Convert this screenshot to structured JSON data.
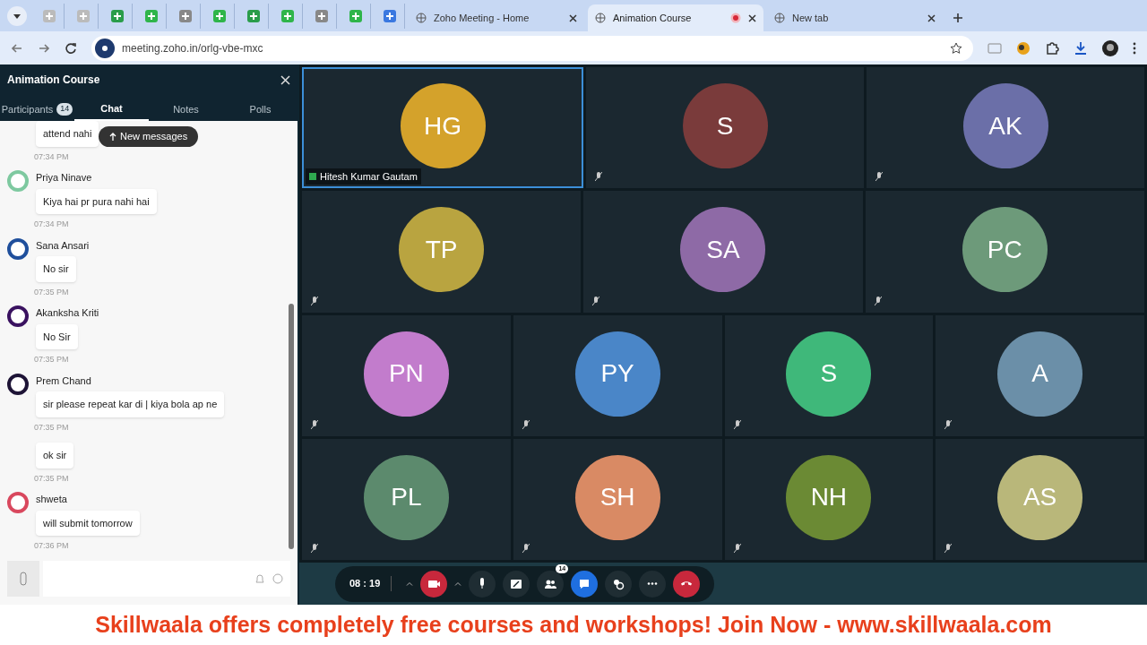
{
  "browser": {
    "tabs": [
      {
        "title": "Zoho Meeting - Home",
        "selected": false,
        "recording": false
      },
      {
        "title": "Animation Course",
        "selected": true,
        "recording": true
      },
      {
        "title": "New tab",
        "selected": false,
        "recording": false
      }
    ],
    "url": "meeting.zoho.in/orlg-vbe-mxc"
  },
  "sidebar": {
    "title": "Animation Course",
    "tabs": [
      {
        "label": "Participants",
        "badge": "14",
        "selected": false
      },
      {
        "label": "Chat",
        "selected": true
      },
      {
        "label": "Notes",
        "selected": false
      },
      {
        "label": "Polls",
        "selected": false
      }
    ],
    "new_messages": "New messages",
    "messages": [
      {
        "text": "attend nahi",
        "time": "07:34 PM"
      },
      {
        "sender": "Priya Ninave",
        "color": "#7ec9a0",
        "text": "Kiya hai pr pura nahi hai",
        "time": "07:34 PM"
      },
      {
        "sender": "Sana Ansari",
        "color": "#1f4f9c",
        "text": "No sir",
        "time": "07:35 PM"
      },
      {
        "sender": "Akanksha Kriti",
        "color": "#3a1260",
        "text": "No Sir",
        "time": "07:35 PM"
      },
      {
        "sender": "Prem Chand",
        "color": "#1e1436",
        "text": "sir please repeat kar di | kiya bola ap ne",
        "time": "07:35 PM"
      },
      {
        "text": "ok sir",
        "time": "07:35 PM"
      },
      {
        "sender": "shweta",
        "color": "#d9485e",
        "text": "will submit tomorrow",
        "time": "07:36 PM"
      }
    ]
  },
  "tile_rows": [
    [
      {
        "initials": "HG",
        "color": "#d4a22b",
        "name": "Hitesh Kumar Gautam",
        "selected": true
      },
      {
        "initials": "S",
        "color": "#7a3b3b",
        "selected": false
      },
      {
        "initials": "AK",
        "color": "#6b6fa8",
        "selected": false
      }
    ],
    [
      {
        "initials": "TP",
        "color": "#b9a440",
        "selected": false
      },
      {
        "initials": "SA",
        "color": "#8e6aa6",
        "selected": false
      },
      {
        "initials": "PC",
        "color": "#6d9a7a",
        "selected": false
      }
    ],
    [
      {
        "initials": "PN",
        "color": "#c27ccc",
        "selected": false
      },
      {
        "initials": "PY",
        "color": "#4a86c8",
        "selected": false
      },
      {
        "initials": "S",
        "color": "#3fb87a",
        "selected": false
      },
      {
        "initials": "A",
        "color": "#6b8fa8",
        "selected": false
      }
    ],
    [
      {
        "initials": "PL",
        "color": "#5c8a6d",
        "selected": false
      },
      {
        "initials": "SH",
        "color": "#d98a64",
        "selected": false
      },
      {
        "initials": "NH",
        "color": "#6b8a34",
        "selected": false
      },
      {
        "initials": "AS",
        "color": "#b9b77a",
        "selected": false
      }
    ]
  ],
  "controls": {
    "timer": "08 : 19",
    "buttons": [
      {
        "kind": "camera",
        "color": "#c8283c",
        "menu": true
      },
      {
        "kind": "mic",
        "menu": true
      },
      {
        "kind": "share"
      },
      {
        "kind": "participants",
        "badge": "14"
      },
      {
        "kind": "chat",
        "color": "#1f6fe0"
      },
      {
        "kind": "reactions"
      },
      {
        "kind": "more"
      },
      {
        "kind": "end",
        "color": "#c8283c"
      }
    ]
  },
  "banner": "Skillwaala offers completely free courses and workshops! Join Now - www.skillwaala.com"
}
